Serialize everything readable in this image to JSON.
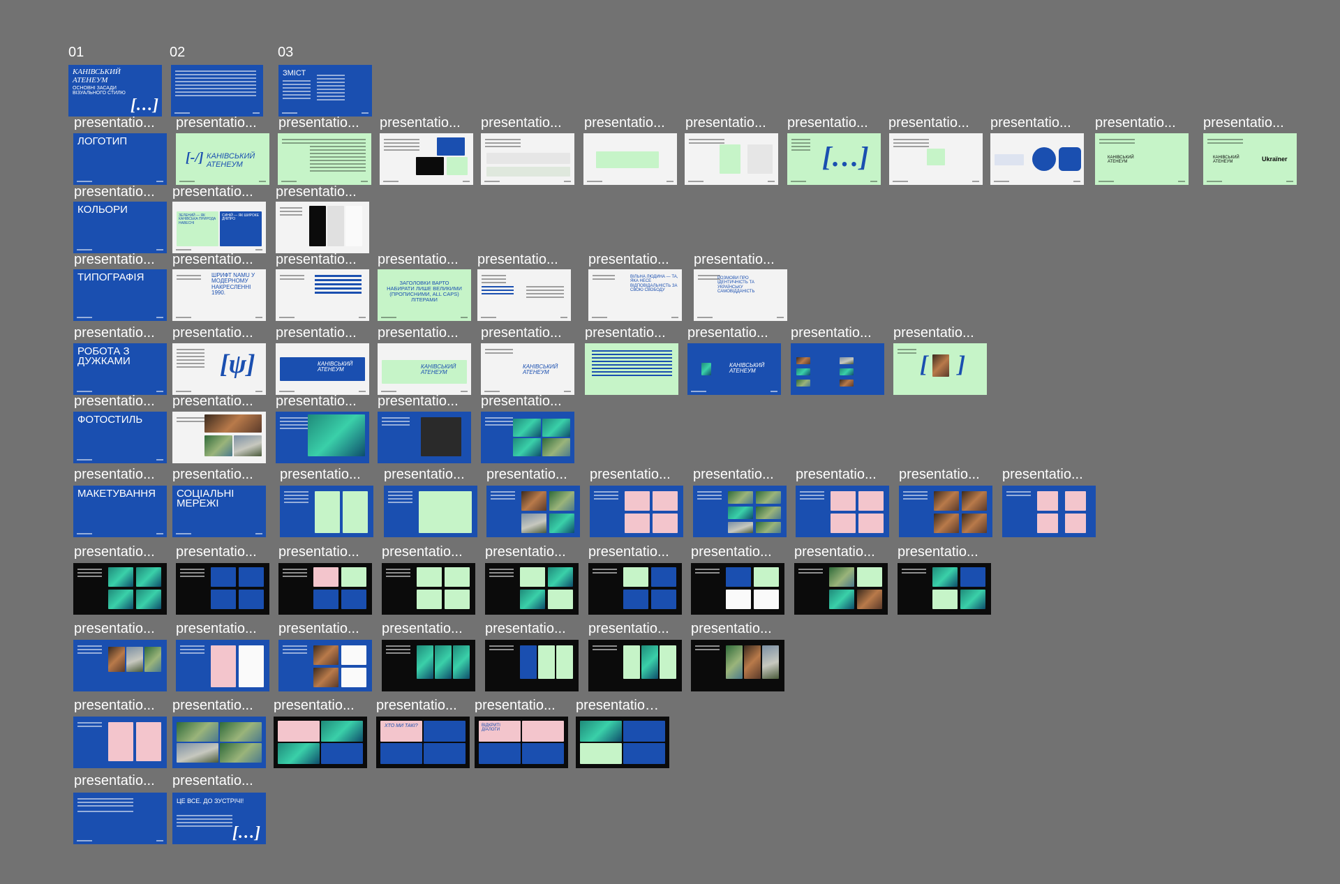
{
  "canvas": {
    "background": "#727272"
  },
  "column_numbers": [
    "01",
    "02",
    "03"
  ],
  "caption_text": "presentatio...",
  "caption_text_6": "presentatio…",
  "colors": {
    "blue": "#1a4fb0",
    "green": "#c6f4c8",
    "white": "#f3f3f3",
    "black": "#0b0b0b",
    "pink": "#f3c5cc"
  },
  "slide_texts": {
    "cover_title": "КАНІВСЬКИЙ АТЕНЕУМ",
    "cover_sub": "ОСНОВНІ ЗАСАДИ ВІЗУАЛЬНОГО СТИЛЮ",
    "contents": "ЗМІСТ",
    "logo": "ЛОГОТИП",
    "logo_word": "КАНІВСЬКИЙ АТЕНЕУМ",
    "colors": "КОЛЬОРИ",
    "colors_green": "ЗЕЛЕНИЙ — ЯК КАНІВСЬКА ПРИРОДА НАВЕСНІ",
    "colors_blue": "СИНІЙ — ЯК ШИРОКЕ ДНІПРО",
    "typography": "ТИПОГРАФІЯ",
    "font_namu": "ШРИФТ NAMU У МОДЕРНОМУ НАКРЕСЛЕННІ 1990.",
    "headlines": "ЗАГОЛОВКИ ВАРТО НАБИРАТИ ЛИШЕ ВЕЛИКИМИ (ПРОПИСНИМИ, ALL CAPS) ЛІТЕРАМИ",
    "free_man": "ВІЛЬНА ЛЮДИНА — ТА, ЯКА НЕСЕ ВІДПОВІДАЛЬНІСТЬ ЗА СВОЮ СВОБОДУ",
    "identity": "РОЗМОВИ ПРО ІДЕНТИЧНІСТЬ ТА УКРАЇНСЬКУ САМОВІДДАНІСТЬ",
    "brackets": "РОБОТА З ДУЖКАМИ",
    "photo_style": "ФОТОСТИЛЬ",
    "layout": "МАКЕТУВАННЯ",
    "social": "СОЦІАЛЬНІ МЕРЕЖІ",
    "who_we_are": "ХТО МИ ТАКІ?",
    "open_dialogues": "ВІДКРИТІ ДІАЛОГИ",
    "goodbye": "ЦЕ ВСЕ. ДО ЗУСТРІЧІ!",
    "ukrainer": "Ukraїner",
    "logo_mark": "[…]",
    "logo_dash": "[-/]"
  }
}
